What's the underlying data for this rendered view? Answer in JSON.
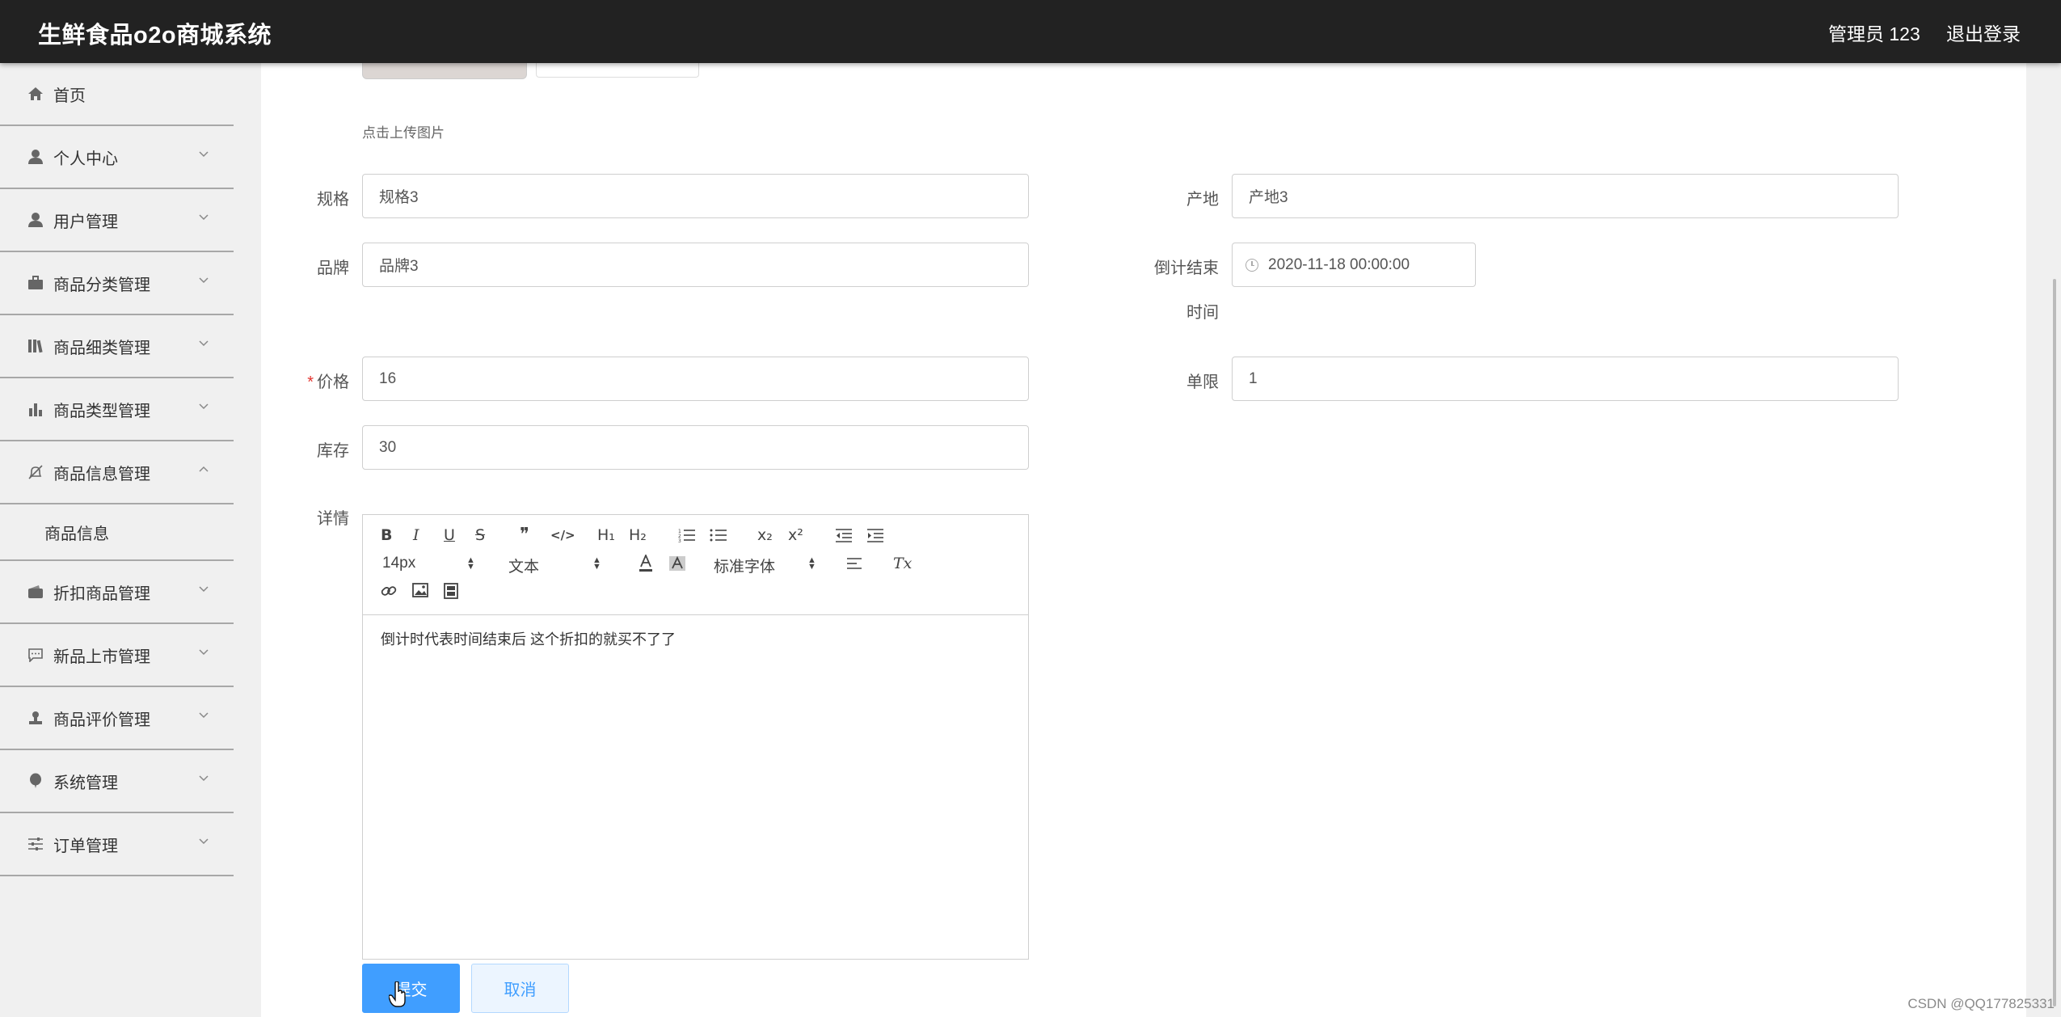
{
  "header": {
    "title": "生鲜食品o2o商城系统",
    "admin": "管理员 123",
    "logout": "退出登录"
  },
  "sidebar": {
    "items": [
      {
        "label": "首页",
        "icon": "home-icon"
      },
      {
        "label": "个人中心",
        "icon": "user-icon"
      },
      {
        "label": "用户管理",
        "icon": "user-icon"
      },
      {
        "label": "商品分类管理",
        "icon": "briefcase-icon"
      },
      {
        "label": "商品细类管理",
        "icon": "books-icon"
      },
      {
        "label": "商品类型管理",
        "icon": "bar-chart-icon"
      },
      {
        "label": "商品信息管理",
        "icon": "bell-off-icon"
      },
      {
        "label": "商品信息",
        "icon": ""
      },
      {
        "label": "折扣商品管理",
        "icon": "wallet-icon"
      },
      {
        "label": "新品上市管理",
        "icon": "message-icon"
      },
      {
        "label": "商品评价管理",
        "icon": "stamp-icon"
      },
      {
        "label": "系统管理",
        "icon": "balloon-icon"
      },
      {
        "label": "订单管理",
        "icon": "sliders-icon"
      }
    ]
  },
  "form": {
    "upload_hint": "点击上传图片",
    "spec_label": "规格",
    "spec_value": "规格3",
    "origin_label": "产地",
    "origin_value": "产地3",
    "brand_label": "品牌",
    "brand_value": "品牌3",
    "countdown_label_1": "倒计结束",
    "countdown_label_2": "时间",
    "countdown_value": "2020-11-18 00:00:00",
    "price_required": "*",
    "price_label": "价格",
    "price_value": "16",
    "limit_label": "单限",
    "limit_value": "1",
    "stock_label": "库存",
    "stock_value": "30",
    "detail_label": "详情"
  },
  "editor": {
    "toolbar": {
      "bold": "B",
      "italic": "I",
      "underline": "U",
      "strike": "S",
      "blockquote": "❞",
      "code": "</>",
      "h1": "H₁",
      "h2": "H₂",
      "sub": "x₂",
      "sup": "x²",
      "size_select": "14px",
      "header_select": "文本",
      "font_select": "标准字体",
      "clean": "Tx"
    },
    "content": "倒计时代表时间结束后  这个折扣的就买不了了"
  },
  "buttons": {
    "submit": "提交",
    "cancel": "取消"
  },
  "watermark": "CSDN @QQ177825331",
  "colors": {
    "topbar": "#222222",
    "primary": "#409eff",
    "sidebar_bg": "#f0f0f0"
  }
}
